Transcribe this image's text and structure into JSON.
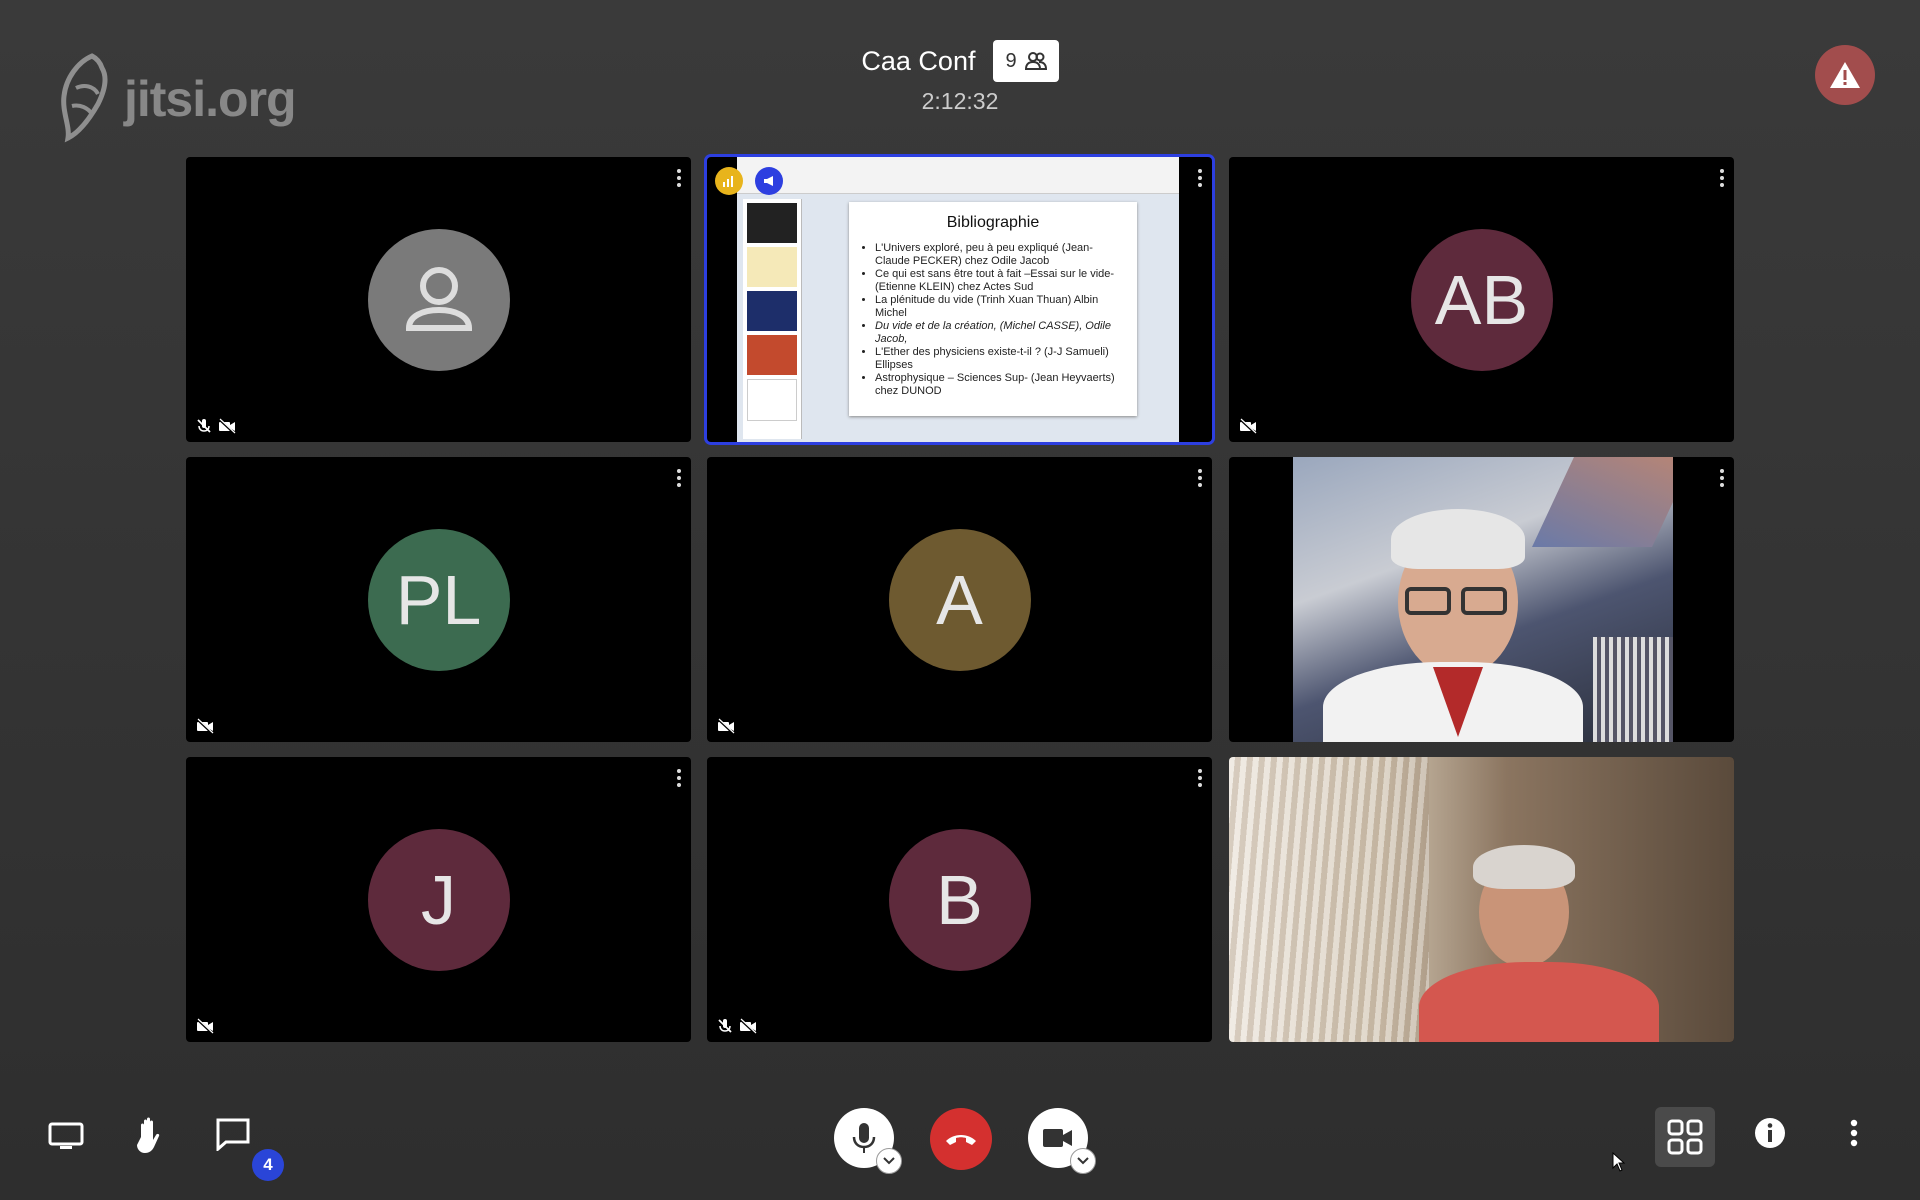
{
  "brand": {
    "logo_text": "jitsi.org"
  },
  "meeting": {
    "title": "Caa Conf",
    "participant_count": "9",
    "timer": "2:12:32"
  },
  "tiles": [
    {
      "type": "avatar",
      "initials": "",
      "avatar_color": "#7a7a7a",
      "muted_audio": true,
      "muted_video": true
    },
    {
      "type": "screenshare",
      "active": true,
      "slide_title": "Bibliographie",
      "slide_items": [
        "L'Univers exploré, peu à peu expliqué (Jean-Claude PECKER) chez Odile Jacob",
        "Ce qui est sans être tout à fait –Essai sur le vide- (Etienne KLEIN) chez Actes Sud",
        "La plénitude du vide (Trinh Xuan Thuan) Albin Michel",
        "Du vide et de la création, (Michel CASSE), Odile Jacob,",
        "L'Ether des physiciens existe-t-il ? (J-J Samueli) Ellipses",
        "Astrophysique – Sciences Sup- (Jean Heyvaerts) chez DUNOD"
      ]
    },
    {
      "type": "avatar",
      "initials": "AB",
      "avatar_color": "#5e2a3c",
      "muted_audio": false,
      "muted_video": true
    },
    {
      "type": "avatar",
      "initials": "PL",
      "avatar_color": "#3c6b50",
      "muted_audio": false,
      "muted_video": true
    },
    {
      "type": "avatar",
      "initials": "A",
      "avatar_color": "#6e5a30",
      "muted_audio": false,
      "muted_video": true
    },
    {
      "type": "video",
      "scene": "man-glasses-attic"
    },
    {
      "type": "avatar",
      "initials": "J",
      "avatar_color": "#5e2a3c",
      "muted_audio": false,
      "muted_video": true
    },
    {
      "type": "avatar",
      "initials": "B",
      "avatar_color": "#5e2a3c",
      "muted_audio": true,
      "muted_video": true
    },
    {
      "type": "video",
      "scene": "man-curtain-window"
    }
  ],
  "toolbar": {
    "chat_unread": "4",
    "icons": {
      "share": "desktop-icon",
      "raise": "raise-hand-icon",
      "chat": "chat-icon",
      "mic": "microphone-icon",
      "hangup": "hangup-icon",
      "camera": "camera-icon",
      "tile": "tile-view-icon",
      "info": "info-icon",
      "more": "more-icon"
    },
    "hangup_color": "#d4302f"
  }
}
